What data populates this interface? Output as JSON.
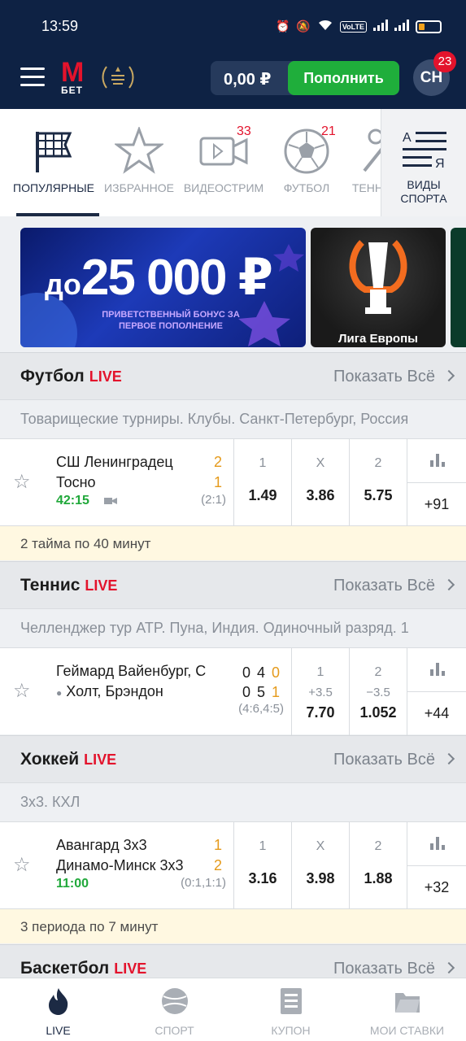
{
  "status_bar": {
    "time": "13:59",
    "network_label": "VoLTE"
  },
  "header": {
    "logo_m": "M",
    "logo_bet": "БЕТ",
    "balance": "0,00 ₽",
    "deposit_label": "Пополнить",
    "avatar_initials": "СН",
    "notifications_count": "23"
  },
  "tabs": [
    {
      "label": "ПОПУЛЯРНЫЕ",
      "icon": "flag-icon",
      "badge": ""
    },
    {
      "label": "ИЗБРАННОЕ",
      "icon": "star-icon",
      "badge": ""
    },
    {
      "label": "ВИДЕОСТРИМ",
      "icon": "video-icon",
      "badge": "33"
    },
    {
      "label": "ФУТБОЛ",
      "icon": "soccer-ball-icon",
      "badge": "21"
    },
    {
      "label": "ТЕННИС",
      "icon": "tennis-icon",
      "badge": ""
    }
  ],
  "sports_button": {
    "line1": "ВИДЫ",
    "line2": "СПОРТА",
    "icon_letter_top": "А",
    "icon_letter_bottom": "Я"
  },
  "banners": {
    "bonus_prefix": "до",
    "bonus_amount": "25 000 ₽",
    "bonus_sub": "ПРИВЕТСТВЕННЫЙ БОНУС ЗА ПЕРВОЕ ПОПОЛНЕНИЕ",
    "europa_caption": "Лига Европы"
  },
  "sections": [
    {
      "title": "Футбол",
      "live": "LIVE",
      "show_all": "Показать Всё",
      "league": "Товарищеские турниры. Клубы. Санкт-Петербург, Россия",
      "event": {
        "team1": "СШ Ленинградец",
        "team2": "Тосно",
        "score1": "2",
        "score2": "1",
        "time": "42:15",
        "period_score": "(2:1)",
        "odds": [
          {
            "head": "1",
            "value": "1.49"
          },
          {
            "head": "X",
            "value": "3.86"
          },
          {
            "head": "2",
            "value": "5.75"
          }
        ],
        "more": "+91"
      },
      "note": "2 тайма по 40 минут"
    },
    {
      "title": "Теннис",
      "live": "LIVE",
      "show_all": "Показать Всё",
      "league": "Челленджер тур ATP. Пуна, Индия. Одиночный разряд. 1",
      "event": {
        "team1": "Геймард Вайенбург, С",
        "team2": "Холт, Брэндон",
        "sets1": [
          "0",
          "4",
          "0"
        ],
        "sets2": [
          "0",
          "5",
          "1"
        ],
        "period_score": "(4:6,4:5)",
        "odds": [
          {
            "head": "1",
            "handicap": "+3.5",
            "value": "7.70"
          },
          {
            "head": "2",
            "handicap": "−3.5",
            "value": "1.052"
          }
        ],
        "more": "+44"
      }
    },
    {
      "title": "Хоккей",
      "live": "LIVE",
      "show_all": "Показать Всё",
      "league": "3х3. КХЛ",
      "event": {
        "team1": "Авангард 3х3",
        "team2": "Динамо-Минск 3х3",
        "score1": "1",
        "score2": "2",
        "time": "11:00",
        "period_score": "(0:1,1:1)",
        "odds": [
          {
            "head": "1",
            "value": "3.16"
          },
          {
            "head": "X",
            "value": "3.98"
          },
          {
            "head": "2",
            "value": "1.88"
          }
        ],
        "more": "+32"
      },
      "note": "3 периода по 7 минут"
    },
    {
      "title": "Баскетбол",
      "live": "LIVE",
      "show_all": "Показать Всё"
    }
  ],
  "bottom_nav": [
    {
      "label": "LIVE",
      "icon": "flame-icon"
    },
    {
      "label": "СПОРТ",
      "icon": "ball-icon"
    },
    {
      "label": "КУПОН",
      "icon": "coupon-icon"
    },
    {
      "label": "МОИ СТАВКИ",
      "icon": "folder-icon"
    }
  ],
  "colors": {
    "header_bg": "#0e2244",
    "accent_red": "#e3132c",
    "deposit_green": "#1fae3b",
    "live_time_green": "#20a83a",
    "score_highlight": "#e59a1b"
  }
}
